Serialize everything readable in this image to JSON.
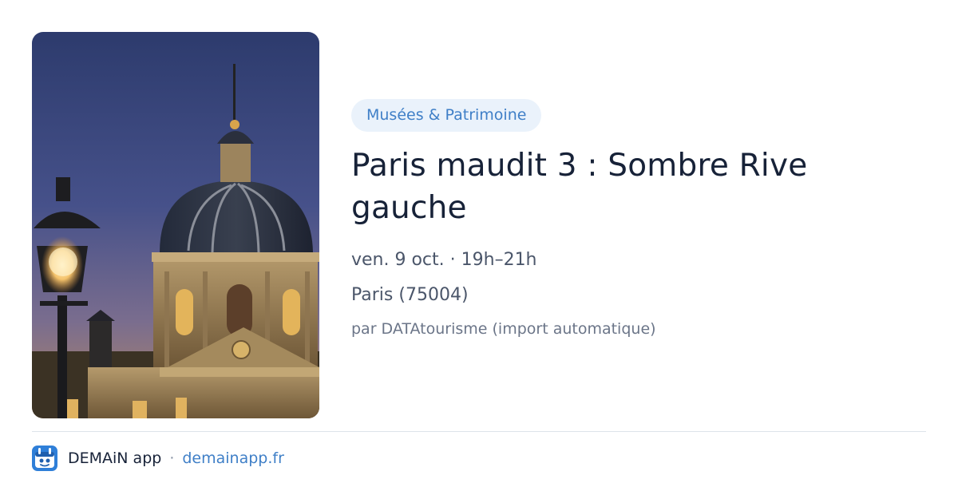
{
  "event": {
    "category": "Musées & Patrimoine",
    "title": "Paris maudit 3 : Sombre Rive gauche",
    "schedule": "ven. 9 oct. · 19h–21h",
    "location": "Paris (75004)",
    "source": "par DATAtourisme (import automatique)",
    "image": "photo-institut-de-france-dome-at-dusk"
  },
  "footer": {
    "app_name": "DEMAiN app",
    "separator": "·",
    "link_text": "demainapp.fr",
    "icon": "demain-app-icon"
  },
  "colors": {
    "accent": "#3f7fc7",
    "pill_background": "#eaf2fb",
    "title": "#172238",
    "muted": "#4b566a"
  }
}
